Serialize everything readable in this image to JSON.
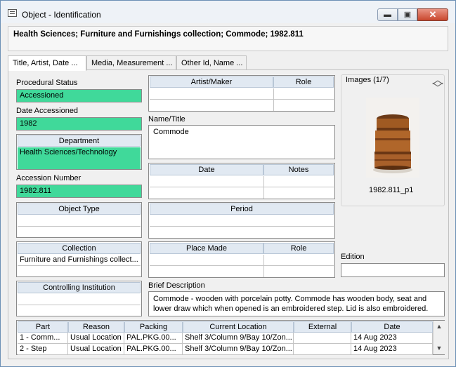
{
  "window": {
    "title": "Object - Identification",
    "min_glyph": "▬",
    "max_glyph": "▣",
    "close_glyph": "✕"
  },
  "header": {
    "text": "Health Sciences; Furniture and Furnishings collection; Commode; 1982.811"
  },
  "tabs": [
    {
      "label": "Title, Artist, Date ..."
    },
    {
      "label": "Media, Measurement ..."
    },
    {
      "label": "Other Id, Name ..."
    }
  ],
  "form": {
    "procedural_status_label": "Procedural Status",
    "procedural_status_value": "Accessioned",
    "date_accessioned_label": "Date Accessioned",
    "date_accessioned_value": "1982",
    "department_header": "Department",
    "department_value": "Health Sciences/Technology",
    "accession_number_label": "Accession Number",
    "accession_number_value": "1982.811",
    "object_type_header": "Object Type",
    "collection_header": "Collection",
    "collection_value": "Furniture and Furnishings collect...",
    "controlling_institution_header": "Controlling Institution",
    "artist_maker_header": "Artist/Maker",
    "role_header": "Role",
    "name_title_label": "Name/Title",
    "name_title_value": "Commode",
    "date_header": "Date",
    "notes_header": "Notes",
    "period_header": "Period",
    "place_made_header": "Place Made",
    "place_role_header": "Role",
    "brief_description_label": "Brief Description",
    "brief_description_value": "Commode - wooden with porcelain potty. Commode has wooden body, seat and lower draw which when opened is an embroidered step. Lid is also embroidered.",
    "edition_label": "Edition"
  },
  "images": {
    "label": "Images (1/7)",
    "caption": "1982.811_p1",
    "nav_up": "︿",
    "nav_down": "﹀"
  },
  "parts_table": {
    "columns": [
      "Part",
      "Reason",
      "Packing",
      "Current Location",
      "External",
      "Date"
    ],
    "rows": [
      [
        "1 - Comm...",
        "Usual Location",
        "PAL.PKG.00...",
        "Shelf 3/Column 9/Bay 10/Zon...",
        "",
        "14 Aug 2023"
      ],
      [
        "2 - Step",
        "Usual Location",
        "PAL.PKG.00...",
        "Shelf 3/Column 9/Bay 10/Zon...",
        "",
        "14 Aug 2023"
      ]
    ],
    "scroll_up": "▲",
    "scroll_down": "▼"
  }
}
